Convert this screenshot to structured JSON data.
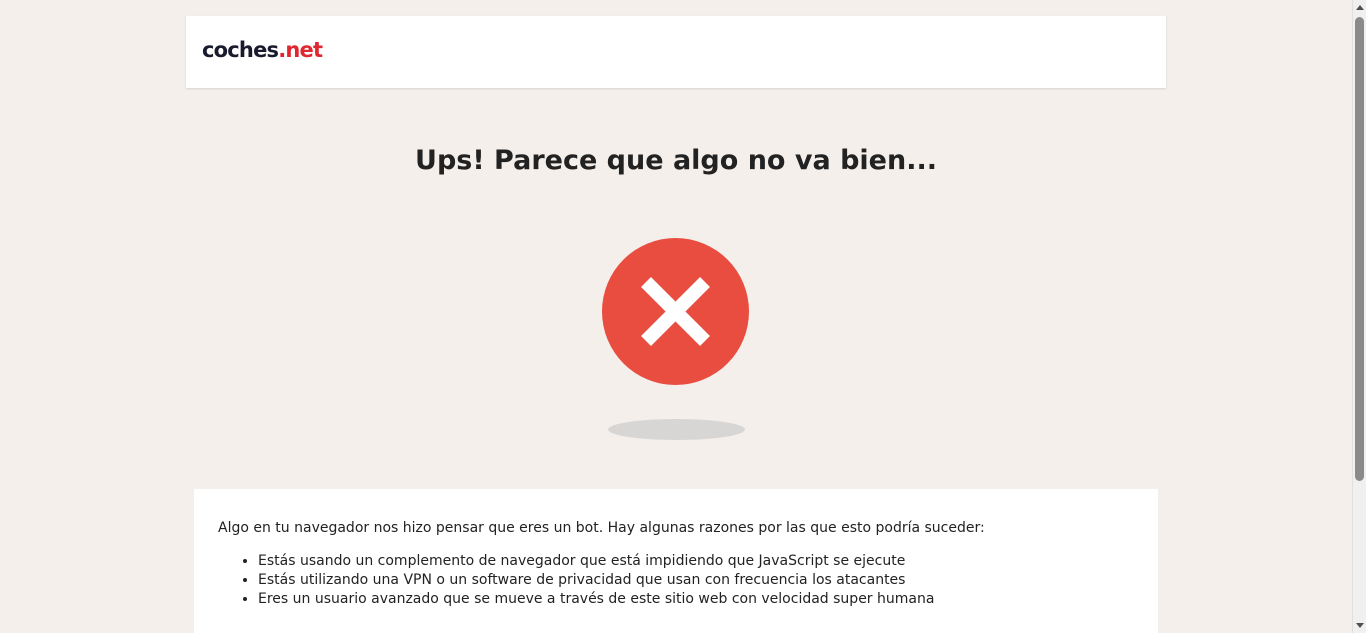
{
  "header": {
    "logo": {
      "part_a": "coches",
      "dot": ".",
      "part_b": "net"
    }
  },
  "main": {
    "title": "Ups! Parece que algo no va bien...",
    "icon": "error-x-circle-icon",
    "message": {
      "intro": "Algo en tu navegador nos hizo pensar que eres un bot. Hay algunas razones por las que esto podría suceder:",
      "reasons": [
        "Estás usando un complemento de navegador que está impidiendo que JavaScript se ejecute",
        "Estás utilizando una VPN o un software de privacidad que usan con frecuencia los atacantes",
        "Eres un usuario avanzado que se mueve a través de este sitio web con velocidad super humana"
      ]
    }
  },
  "colors": {
    "background": "#f4efeb",
    "brand_dark": "#1a1a2e",
    "brand_red": "#e0262e",
    "error_red": "#e84d40",
    "text": "#222222"
  }
}
